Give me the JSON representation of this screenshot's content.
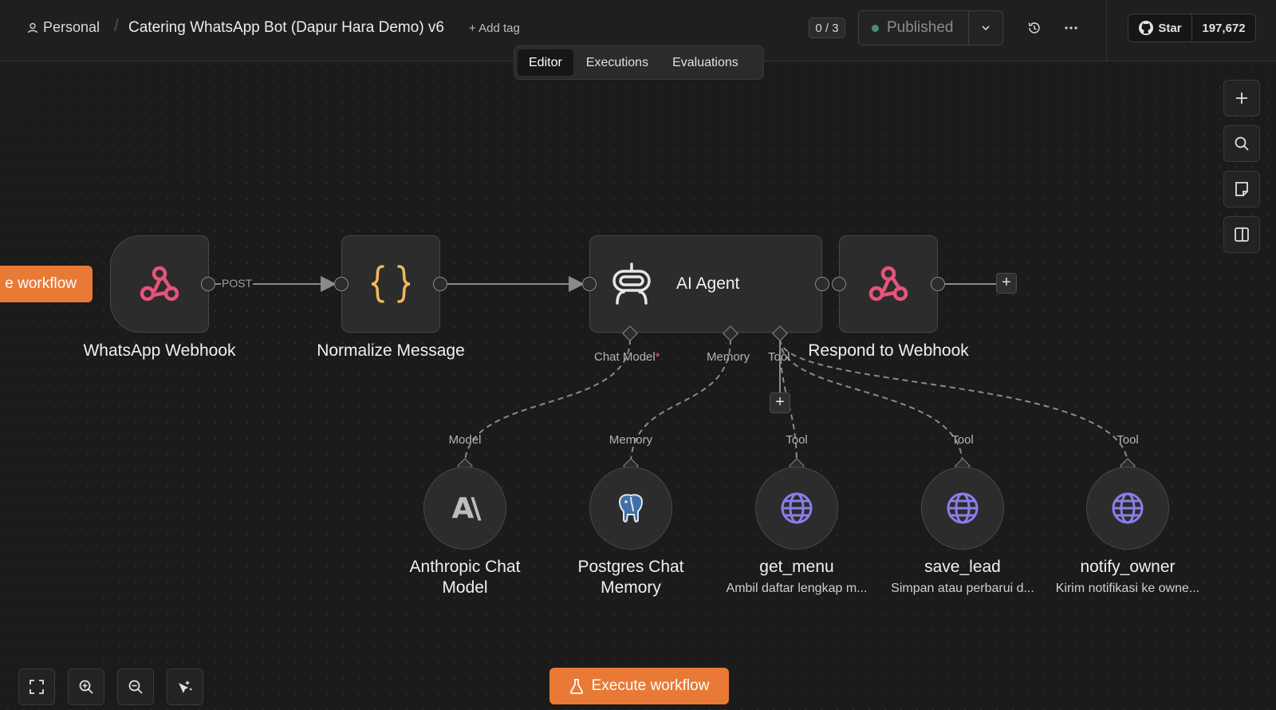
{
  "header": {
    "project": "Personal",
    "workflow_title": "Catering WhatsApp Bot (Dapur Hara Demo) v6",
    "add_tag": "+ Add tag",
    "counter": "0 / 3",
    "publish_status": "Published",
    "github_star": "Star",
    "github_count": "197,672"
  },
  "tabs": [
    {
      "label": "Editor",
      "active": true
    },
    {
      "label": "Executions",
      "active": false
    },
    {
      "label": "Evaluations",
      "active": false
    }
  ],
  "canvas": {
    "partial_button": "e workflow",
    "edge_label_post": "POST",
    "nodes": {
      "webhook": {
        "label": "WhatsApp Webhook",
        "icon": "webhook-icon"
      },
      "normalize": {
        "label": "Normalize Message",
        "icon": "code-braces-icon"
      },
      "agent": {
        "label": "AI Agent",
        "icon": "robot-icon"
      },
      "respond": {
        "label": "Respond to Webhook",
        "icon": "webhook-icon"
      }
    },
    "agent_ports": {
      "chat_model": "Chat Model",
      "required_mark": "*",
      "memory": "Memory",
      "tool": "Tool"
    },
    "sub_nodes": [
      {
        "port_label": "Model",
        "name_line1": "Anthropic Chat",
        "name_line2": "Model",
        "subtitle": "",
        "icon": "anthropic-icon"
      },
      {
        "port_label": "Memory",
        "name_line1": "Postgres Chat",
        "name_line2": "Memory",
        "subtitle": "",
        "icon": "postgres-elephant-icon"
      },
      {
        "port_label": "Tool",
        "name_line1": "get_menu",
        "name_line2": "",
        "subtitle": "Ambil daftar lengkap m...",
        "icon": "globe-icon"
      },
      {
        "port_label": "Tool",
        "name_line1": "save_lead",
        "name_line2": "",
        "subtitle": "Simpan atau perbarui d...",
        "icon": "globe-icon"
      },
      {
        "port_label": "Tool",
        "name_line1": "notify_owner",
        "name_line2": "",
        "subtitle": "Kirim notifikasi ke owne...",
        "icon": "globe-icon"
      }
    ]
  },
  "footer": {
    "execute_label": "Execute workflow"
  },
  "colors": {
    "accent": "#e97a36",
    "webhook_icon": "#e6547a",
    "code_icon": "#f0b85a",
    "globe_icon": "#8a7ee6",
    "status_dot": "#4f8d6a"
  }
}
